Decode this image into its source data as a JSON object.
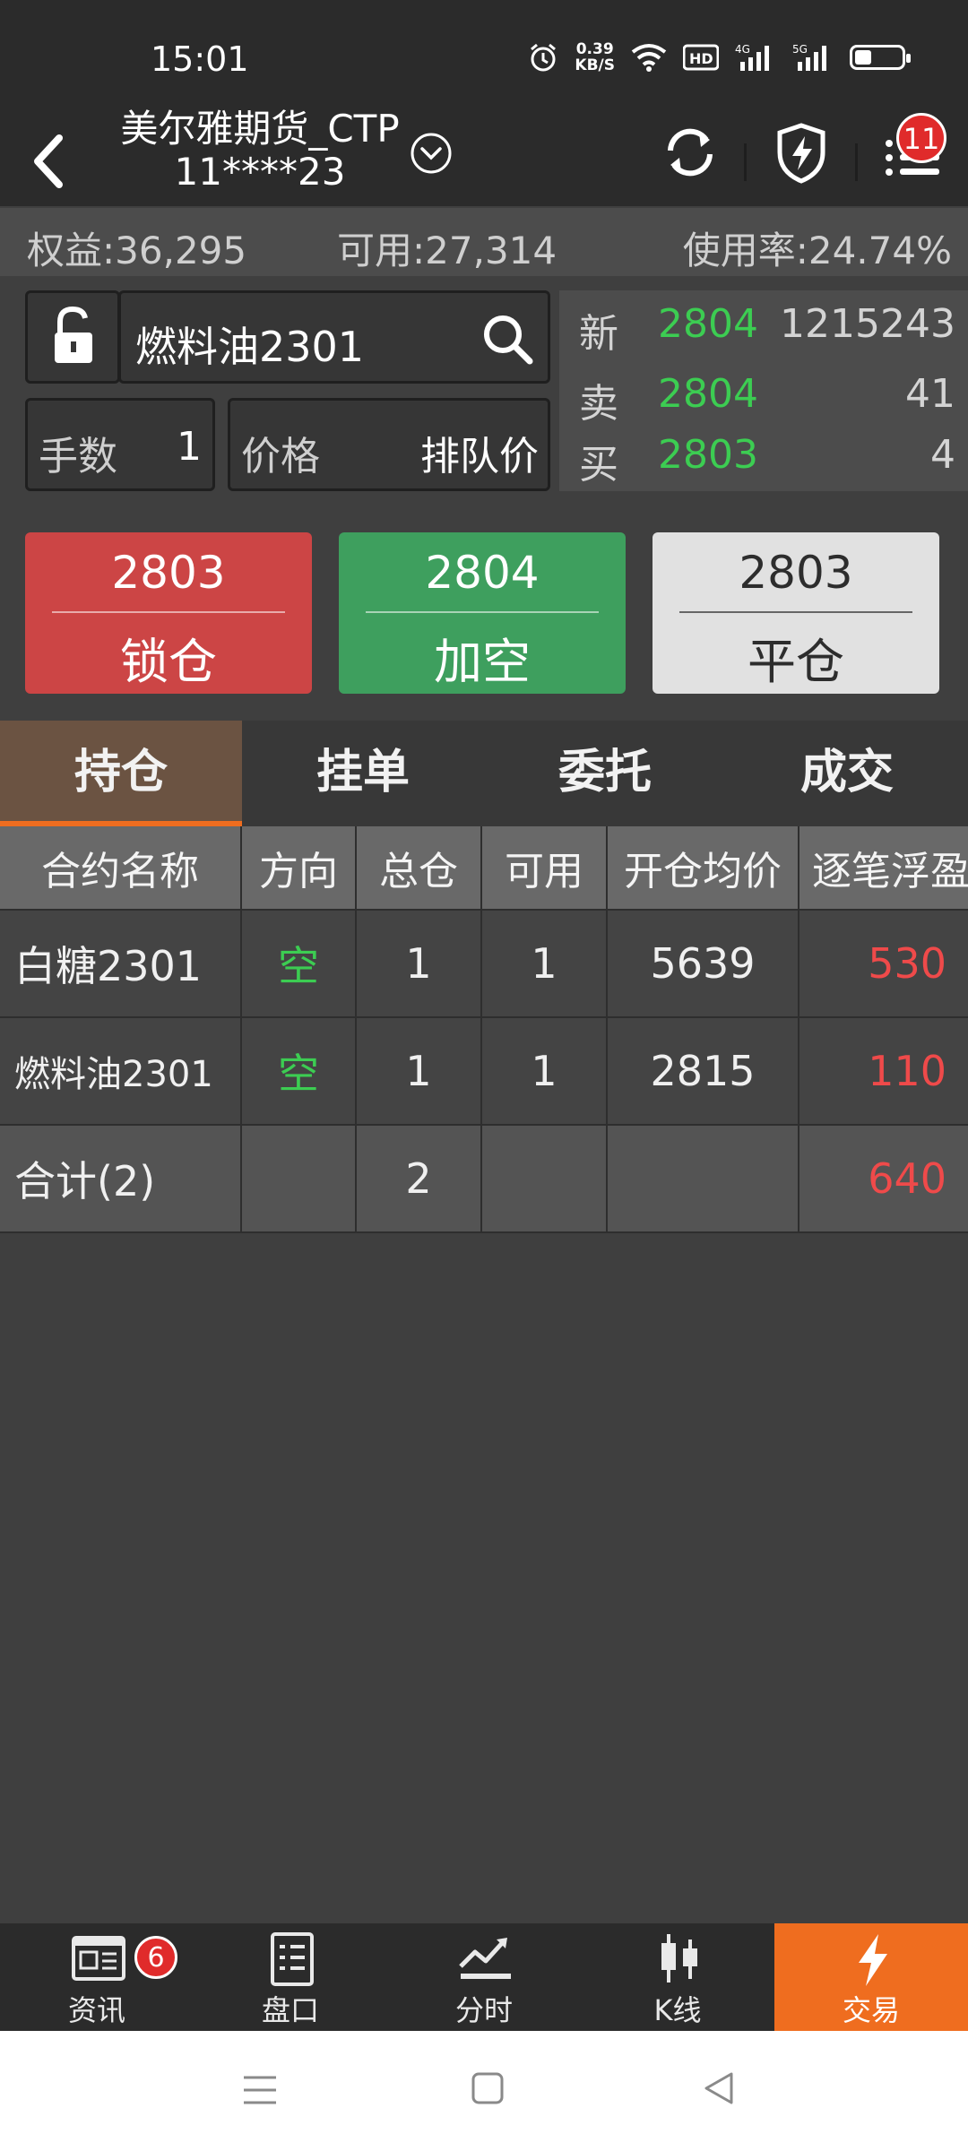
{
  "status_bar": {
    "time": "15:01",
    "speed_value": "0.39",
    "speed_unit": "KB/S",
    "icons": [
      "alarm-icon",
      "wifi-icon",
      "hd-icon",
      "4g-signal-icon",
      "5g-signal-icon",
      "battery-icon"
    ]
  },
  "header": {
    "title": "美尔雅期货_CTP",
    "account_id": "11****23",
    "menu_badge": "11"
  },
  "summary": {
    "equity": "权益:36,295",
    "available": "可用:27,314",
    "usage": "使用率:24.74%"
  },
  "order": {
    "contract": "燃料油2301",
    "qty_label": "手数",
    "qty_value": "1",
    "price_label": "价格",
    "price_value": "排队价"
  },
  "quote": {
    "rows": [
      {
        "label": "新",
        "price": "2804",
        "volume": "1215243"
      },
      {
        "label": "卖",
        "price": "2804",
        "volume": "41"
      },
      {
        "label": "买",
        "price": "2803",
        "volume": "4"
      }
    ]
  },
  "actions": {
    "lock": {
      "price": "2803",
      "label": "锁仓"
    },
    "short": {
      "price": "2804",
      "label": "加空"
    },
    "close": {
      "price": "2803",
      "label": "平仓"
    }
  },
  "tabs": [
    "持仓",
    "挂单",
    "委托",
    "成交"
  ],
  "table": {
    "headers": [
      "合约名称",
      "方向",
      "总仓",
      "可用",
      "开仓均价",
      "逐笔浮盈"
    ],
    "rows": [
      {
        "name": "白糖2301",
        "direction": "空",
        "total": "1",
        "available": "1",
        "avg_price": "5639",
        "pnl": "530"
      },
      {
        "name": "燃料油2301",
        "direction": "空",
        "total": "1",
        "available": "1",
        "avg_price": "2815",
        "pnl": "110"
      }
    ],
    "total": {
      "name": "合计(2)",
      "total": "2",
      "pnl": "640"
    }
  },
  "bottom_nav": {
    "items": [
      "资讯",
      "盘口",
      "分时",
      "K线",
      "交易"
    ],
    "news_badge": "6"
  },
  "colors": {
    "up_red": "#ef4a4a",
    "down_green": "#3ccd52",
    "accent_orange": "#ef6d1f",
    "lock_red": "#cc4545",
    "short_green": "#3e9f5e"
  }
}
